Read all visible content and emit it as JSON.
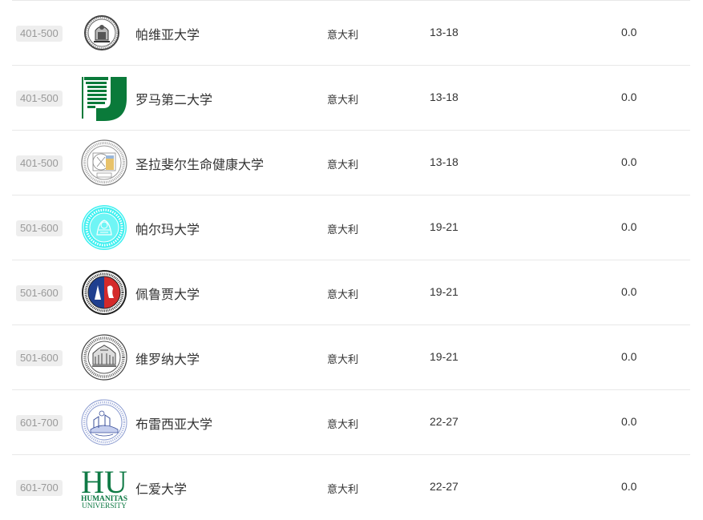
{
  "rows": [
    {
      "rank": "401-500",
      "name": "帕维亚大学",
      "country": "意大利",
      "national_rank": "13-18",
      "score": "0.0",
      "logo_icon": "pavia-seal-icon"
    },
    {
      "rank": "401-500",
      "name": "罗马第二大学",
      "country": "意大利",
      "national_rank": "13-18",
      "score": "0.0",
      "logo_icon": "tor-vergata-logo-icon"
    },
    {
      "rank": "401-500",
      "name": "圣拉斐尔生命健康大学",
      "country": "意大利",
      "national_rank": "13-18",
      "score": "0.0",
      "logo_icon": "san-raffaele-seal-icon"
    },
    {
      "rank": "501-600",
      "name": "帕尔玛大学",
      "country": "意大利",
      "national_rank": "19-21",
      "score": "0.0",
      "logo_icon": "parma-seal-icon"
    },
    {
      "rank": "501-600",
      "name": "佩鲁贾大学",
      "country": "意大利",
      "national_rank": "19-21",
      "score": "0.0",
      "logo_icon": "perugia-seal-icon"
    },
    {
      "rank": "501-600",
      "name": "维罗纳大学",
      "country": "意大利",
      "national_rank": "19-21",
      "score": "0.0",
      "logo_icon": "verona-seal-icon"
    },
    {
      "rank": "601-700",
      "name": "布雷西亚大学",
      "country": "意大利",
      "national_rank": "22-27",
      "score": "0.0",
      "logo_icon": "brescia-seal-icon"
    },
    {
      "rank": "601-700",
      "name": "仁爱大学",
      "country": "意大利",
      "national_rank": "22-27",
      "score": "0.0",
      "logo_icon": "humanitas-logo-icon"
    }
  ],
  "logo_text": {
    "humanitas_mark": "HU",
    "humanitas_line1": "HUMANITAS",
    "humanitas_line2": "UNIVERSITY"
  },
  "colors": {
    "divider": "#e8e8e8",
    "badge_bg": "#eeeeee",
    "badge_text": "#999999",
    "text": "#333333",
    "tor_vergata_green": "#0a7a3a",
    "parma_cyan": "#3ff0f0",
    "perugia_blue": "#1f3f8f",
    "perugia_red": "#d42a2a",
    "brescia_blue": "#3a4f9a",
    "humanitas_green": "#0f7a45"
  }
}
